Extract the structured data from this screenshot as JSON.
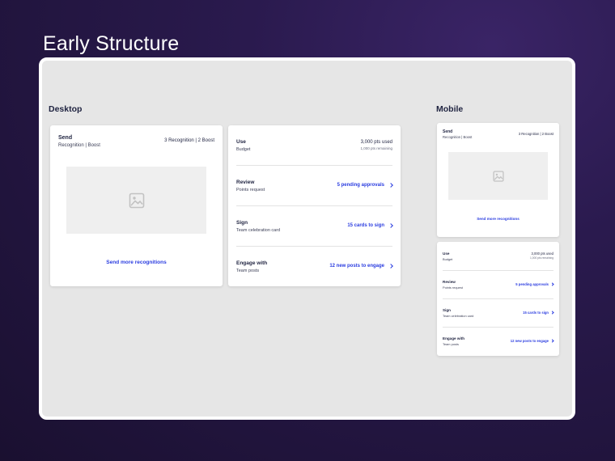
{
  "page": {
    "title": "Early Structure"
  },
  "desktop": {
    "label": "Desktop",
    "send_card": {
      "title": "Send",
      "subtitle": "Recognition | Boost",
      "meta": "3 Recognition | 2 Boost",
      "image_icon": "image-icon",
      "link": "Send more recognitions"
    },
    "list_card": {
      "rows": [
        {
          "title": "Use",
          "subtitle": "Budget",
          "value": "3,000 pts used",
          "value_sub": "1,000 pts remaining"
        },
        {
          "title": "Review",
          "subtitle": "Points request",
          "action": "5 pending approvals"
        },
        {
          "title": "Sign",
          "subtitle": "Team celebration card",
          "action": "15 cards to sign"
        },
        {
          "title": "Engage with",
          "subtitle": "Team posts",
          "action": "12 new posts to engage"
        }
      ]
    }
  },
  "mobile": {
    "label": "Mobile",
    "send_card": {
      "title": "Send",
      "subtitle": "Recognition | Boost",
      "meta": "3 Recognition | 2 Boost",
      "image_icon": "image-icon",
      "link": "Send more recognitions"
    },
    "list_card": {
      "rows": [
        {
          "title": "Use",
          "subtitle": "Budget",
          "value": "3,000 pts used",
          "value_sub": "1,000 pts remaining"
        },
        {
          "title": "Review",
          "subtitle": "Points request",
          "action": "5 pending approvals"
        },
        {
          "title": "Sign",
          "subtitle": "Team celebration card",
          "action": "15 cards to sign"
        },
        {
          "title": "Engage with",
          "subtitle": "Team posts",
          "action": "12 new posts to engage"
        }
      ]
    }
  },
  "colors": {
    "accent": "#2a3ce0",
    "frame": "#e6e6e6",
    "background": "#2a1a4e"
  }
}
